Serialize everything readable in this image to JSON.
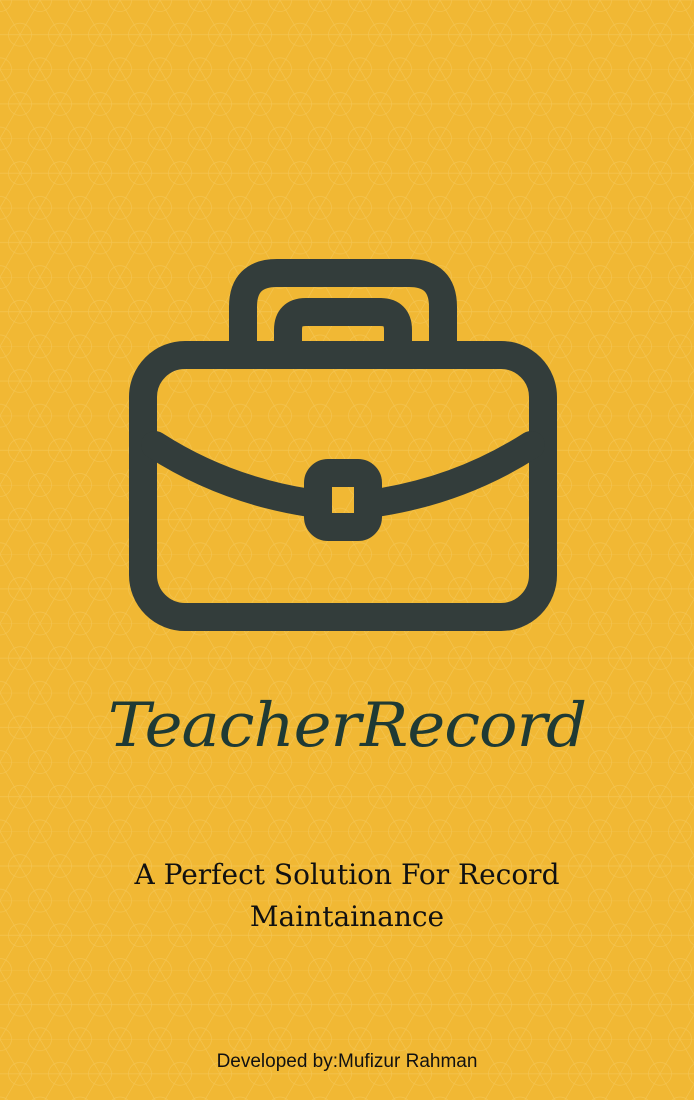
{
  "splash": {
    "app_title": "TeacherRecord",
    "tagline": "A Perfect Solution For Record Maintainance",
    "developer_credit": "Developed by:Mufizur Rahman",
    "icon": "briefcase-icon"
  },
  "colors": {
    "background": "#f1b834",
    "pattern_line": "#f6cd66",
    "icon": "#333d3b",
    "title": "#1f3a34",
    "text": "#111111"
  }
}
